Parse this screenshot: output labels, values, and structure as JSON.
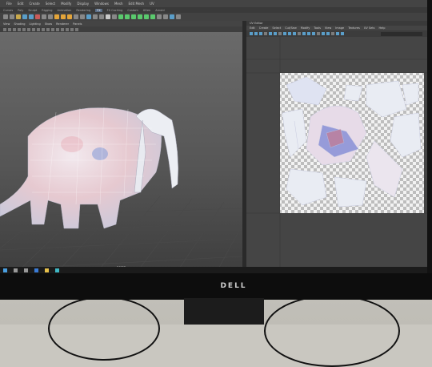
{
  "menu": [
    "File",
    "Edit",
    "Create",
    "Select",
    "Modify",
    "Display",
    "Windows",
    "Mesh",
    "Edit Mesh",
    "UV"
  ],
  "shelf": [
    "Curves",
    "Poly",
    "Sculpt",
    "Rigging",
    "Animation",
    "Rendering",
    "FX",
    "FX Caching",
    "Custom",
    "XGen",
    "Arnold"
  ],
  "viewport": {
    "menu": [
      "View",
      "Shading",
      "Lighting",
      "Show",
      "Renderer",
      "Panels"
    ],
    "camera_label": "",
    "persp_label": "persp"
  },
  "uv_editor": {
    "title": "UV Editor",
    "menu": [
      "Edit",
      "Create",
      "Select",
      "Cut/Sew",
      "Modify",
      "Tools",
      "View",
      "Image",
      "Textures",
      "UV Sets",
      "Help"
    ],
    "uv_set": "",
    "status": ""
  },
  "monitor": {
    "brand": "DELL"
  },
  "colors": {
    "accent": "#2e6db0",
    "viewport_bg": "#565656",
    "ui_bg": "#444444"
  }
}
